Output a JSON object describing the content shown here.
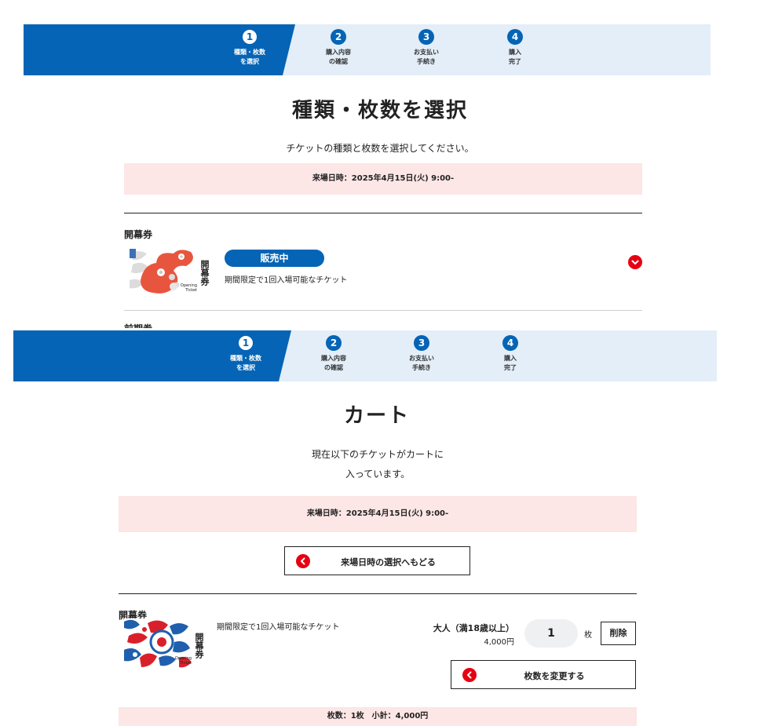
{
  "steps": [
    {
      "num": "1",
      "label_1": "種類・枚数",
      "label_2": "を選択"
    },
    {
      "num": "2",
      "label_1": "購入内容",
      "label_2": "の確認"
    },
    {
      "num": "3",
      "label_1": "お支払い",
      "label_2": "手続き"
    },
    {
      "num": "4",
      "label_1": "購入",
      "label_2": "完了"
    }
  ],
  "select_page": {
    "title": "種類・枚数を選択",
    "instruction": "チケットの種類と枚数を選択してください。",
    "visit_date": "来場日時：2025年4月15日(火) 9:00-",
    "section_label": "開幕券",
    "ticket": {
      "art_text": "開幕券",
      "art_sub_1": "Opening",
      "art_sub_2": "Ticket",
      "status_badge": "販売中",
      "description": "期間限定で1回入場可能なチケット",
      "expand_icon": "chevron-down-icon"
    },
    "next_section_label": "前期券"
  },
  "cart_page": {
    "title": "カート",
    "message_line1": "現在以下のチケットがカートに",
    "message_line2": "入っています。",
    "visit_date": "来場日時：2025年4月15日(火) 9:00-",
    "back_button": "来場日時の選択へもどる",
    "item": {
      "section_label": "開幕券",
      "art_text": "開幕券",
      "art_sub_1": "Opening",
      "art_sub_2": "Ticket",
      "description": "期間限定で1回入場可能なチケット",
      "ticket_type": "大人（満18歳以上）",
      "price": "4,000円",
      "quantity": "1",
      "unit": "枚",
      "delete_button": "削除",
      "change_button": "枚数を変更する"
    },
    "summary": "枚数：1枚　小計：4,000円"
  },
  "colors": {
    "primary_blue": "#0564b5",
    "stepbar_bg": "#e3eef8",
    "date_bg": "#fce6e6",
    "accent_red": "#e60012"
  }
}
